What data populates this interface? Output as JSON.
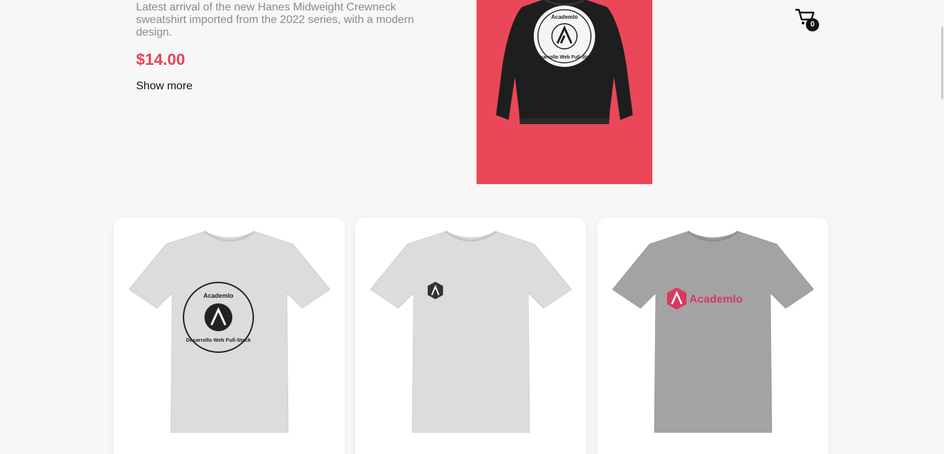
{
  "hero": {
    "description": "Latest arrival of the new Hanes Midweight Crewneck sweatshirt imported from the 2022 series, with a modern design.",
    "price": "$14.00",
    "show_more": "Show more",
    "image_bg": "#ea4858",
    "print_top": "Academlo",
    "print_bottom": "Desarrollo Web Full-Stack"
  },
  "cart": {
    "count": "0"
  },
  "products": [
    {
      "shirt_color": "#d9d9d9",
      "print": "circle",
      "print_top": "Academlo",
      "print_bottom": "Desarrollo Web Full-Stack"
    },
    {
      "shirt_color": "#d9d9d9",
      "print": "small-logo"
    },
    {
      "shirt_color": "#a3a3a3",
      "print": "brand",
      "brand_text": "Academlo",
      "brand_color": "#d63a63"
    }
  ],
  "colors": {
    "accent": "#e84455",
    "text": "#111111",
    "muted": "#8a8a8a"
  }
}
